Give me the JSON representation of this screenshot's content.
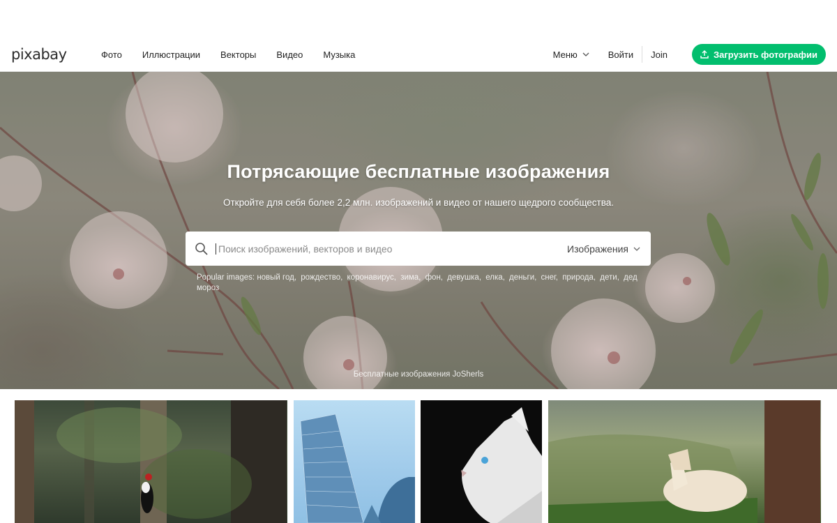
{
  "header": {
    "logo": "pixabay",
    "nav": [
      "Фото",
      "Иллюстрации",
      "Векторы",
      "Видео",
      "Музыка"
    ],
    "menu_label": "Меню",
    "login_label": "Войти",
    "join_label": "Join",
    "upload_label": "Загрузить фотографии"
  },
  "hero": {
    "title": "Потрясающие бесплатные изображения",
    "subtitle": "Откройте для себя более 2,2 млн. изображений и видео от нашего щедрого сообщества.",
    "search": {
      "placeholder": "Поиск изображений, векторов и видео",
      "value": "",
      "type_selected": "Изображения"
    },
    "popular_label": "Popular images:",
    "popular_tags": [
      "новый год,",
      "рождество,",
      "коронавирус,",
      "зима,",
      "фон,",
      "девушка,",
      "елка,",
      "деньги,",
      "снег,",
      "природа,",
      "дети,",
      "дед мороз"
    ],
    "credit": "Бесплатные изображения JoSherls"
  },
  "colors": {
    "accent": "#02be6e",
    "text": "#1f1f1f"
  }
}
